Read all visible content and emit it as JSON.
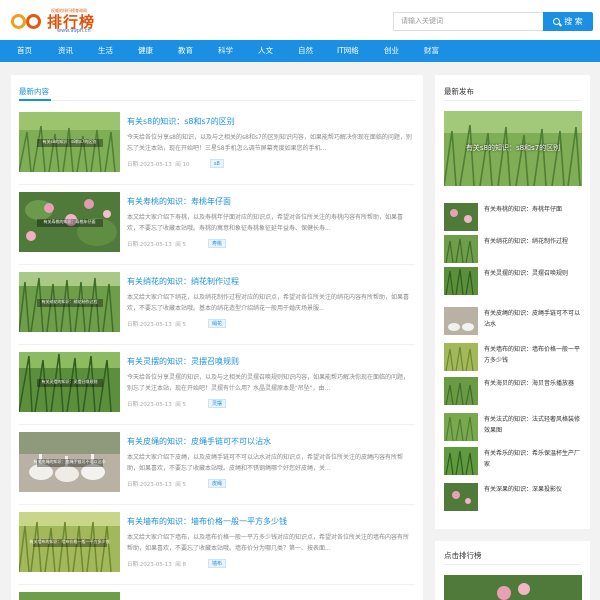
{
  "header": {
    "logo_tagline": "权威的排行榜查询网",
    "logo_title": "排行榜",
    "logo_url": "www.99ph.cn",
    "search_placeholder": "请输入关键词",
    "search_button": "搜 索"
  },
  "nav": [
    "首页",
    "资讯",
    "生活",
    "健康",
    "教育",
    "科学",
    "人文",
    "自然",
    "IT网络",
    "创业",
    "财富"
  ],
  "main": {
    "heading": "最新内容",
    "articles": [
      {
        "title": "有关s8的知识：s8和s7的区别",
        "thumb_caption": "有关s8的知识：s8和s7的区别",
        "desc": "今天给各位分享s8的知识，以及与之相关的s8和s7的区别知识内容，如果能帮巧解决你现在面临的问题，别忘了关注本站，现在开始吧！三星S8手机怎么调节屏幕亮度如果您的手机...",
        "date": "日期 2023-05-13",
        "views": "阅 10",
        "tag": "s8"
      },
      {
        "title": "有关寿桃的知识：寿桃年仔面",
        "thumb_caption": "有关寿桃的知识：寿桃年仔面",
        "desc": "本文给大家介绍下寿桃，以及寿桃年仔面对应的知识点，希望对各位所关注的寿桃内容有所帮助，如果喜欢，不要忘了收藏本站哦。寿桃的寓意和象征寿桃象征延年益寿、保健长寿...",
        "date": "日期 2023-05-13",
        "views": "阅 5",
        "tag": "寿桃"
      },
      {
        "title": "有关绡花的知识：绡花制作过程",
        "thumb_caption": "有关绡花的知识：绡花制作过程",
        "desc": "本文给大家介绍下绡花，以及绡花制作过程对应的知识点，希望对各位所关注的绡花内容有所帮助，如果喜欢，不要忘了收藏本站哦。基本的绡花造型介绍绡花一般用于婚庆场景服...",
        "date": "日期 2023-05-13",
        "views": "阅 5",
        "tag": "绡花"
      },
      {
        "title": "有关灵摆的知识：灵摆召唤规则",
        "thumb_caption": "有关灵摆的知识：灵摆召唤规则",
        "desc": "今天给各位分享灵摆的知识，以及与之相关的灵摆召唤规则知识内容，如果能帮巧解决你现在面临的问题，别忘了关注本站，现在开始吧！灵摆有什么用？水晶灵摆原本是\"吊坠\"，由...",
        "date": "日期 2023-05-13",
        "views": "阅 5",
        "tag": "灵摆"
      },
      {
        "title": "有关皮绳的知识：皮绳手链可不可以沾水",
        "thumb_caption": "有关皮绳的知识：皮绳手链可不可以沾水",
        "desc": "本文给大家介绍下皮绳，以及皮绳手链可不可以沾水对应的知识点，希望对各位所关注的皮绳内容有所帮助，如果喜欢，不要忘了收藏本站哦。皮绳和不锈钢绳哪个好您好皮绳，关...",
        "date": "日期 2023-05-13",
        "views": "阅 5",
        "tag": "皮绳"
      },
      {
        "title": "有关墙布的知识：墙布价格一般一平方多少钱",
        "thumb_caption": "有关墙布的知识：墙布价格一般一平方多少钱",
        "desc": "本文给大家介绍下墙布，以及墙布价格一般一平方多少钱对应的知识点，希望对各位所关注的墙布内容有所帮助，如果喜欢，不要忘了收藏本站哦。墙布价分为哪几类？第一、按表面...",
        "date": "日期 2023-05-13",
        "views": "阅 8",
        "tag": "墙布"
      }
    ]
  },
  "sidebar": {
    "heading": "最新发布",
    "hero_caption": "有关s8的知识：s8和s7的区别",
    "items": [
      "有关寿桃的知识：寿桃年仔面",
      "有关绡花的知识：绡花制作过程",
      "有关灵摆的知识：灵摆召唤规则",
      "有关皮绳的知识：皮绳手链可不可以沾水",
      "有关墙布的知识：墙布价格一般一平方多少钱",
      "有关海贝的知识：海贝音乐播放器",
      "有关法式的知识：法式轻奢风格装修效果图",
      "有关希乐的知识：希乐保温杯生产厂家",
      "有关深果的知识：深果投影仪"
    ],
    "rank_heading": "点击排行榜"
  },
  "colors": {
    "accent": "#1a8fe3",
    "brand": "#e0520a",
    "grass": "#6aa84f"
  }
}
